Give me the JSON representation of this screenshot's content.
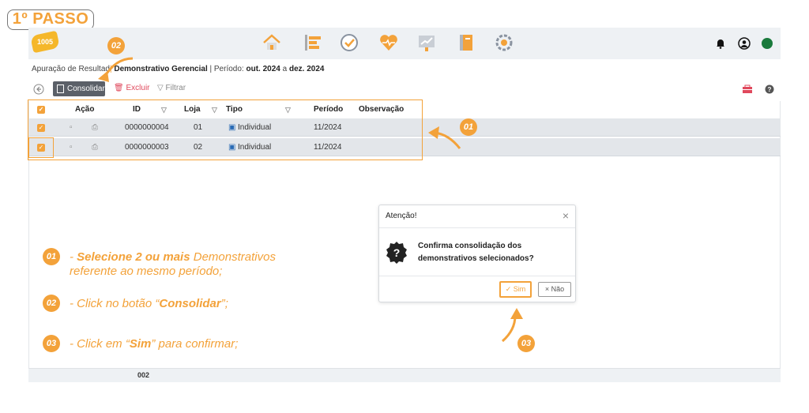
{
  "step": {
    "label": "1º PASSO"
  },
  "logo": {
    "text": "1005"
  },
  "nav": {
    "icons": [
      "home-icon",
      "list-icon",
      "check-circle-icon",
      "heart-pulse-icon",
      "chart-board-icon",
      "notebook-icon",
      "gear-cluster-icon"
    ]
  },
  "header_right": {
    "icons": [
      "bell-icon",
      "user-icon",
      "status-dot-icon"
    ],
    "status_color": "#1a7a3c"
  },
  "breadcrumb": {
    "prefix": "Apuração de Resultad",
    "sep": "|",
    "title": "Demonstrativo Gerencial",
    "period_label": "| Período:",
    "period_from": "out. 2024",
    "a": "a",
    "period_to": "dez. 2024"
  },
  "toolbar": {
    "consolidar": "Consolidar",
    "excluir": "Excluir",
    "filtrar": "Filtrar"
  },
  "table": {
    "headers": {
      "acao": "Ação",
      "id": "ID",
      "loja": "Loja",
      "tipo": "Tipo",
      "periodo": "Período",
      "observacao": "Observação"
    },
    "rows": [
      {
        "id": "0000000004",
        "loja": "01",
        "tipo": "Individual",
        "periodo": "11/2024",
        "checked": true
      },
      {
        "id": "0000000003",
        "loja": "02",
        "tipo": "Individual",
        "periodo": "11/2024",
        "checked": true
      }
    ],
    "footer_value": "002"
  },
  "badges": {
    "b01": "01",
    "b02": "02",
    "b03": "03"
  },
  "instructions": {
    "i1_dash": "- ",
    "i1_bold": "Selecione 2 ou mais",
    "i1_rest": " Demonstrativos",
    "i1_line2": "referente ao mesmo período;",
    "i2_pre": "- Click no botão “",
    "i2_bold": "Consolidar",
    "i2_post": "”;",
    "i3_pre": "- Click em “",
    "i3_bold": "Sim",
    "i3_post": "” para confirmar;"
  },
  "dialog": {
    "title": "Atenção!",
    "message": "Confirma consolidação dos demonstrativos selecionados?",
    "sim": "Sim",
    "nao": "Não"
  },
  "colors": {
    "accent": "#f3a23a",
    "grid_row": "#e3e6ea",
    "danger": "#e0485c"
  }
}
